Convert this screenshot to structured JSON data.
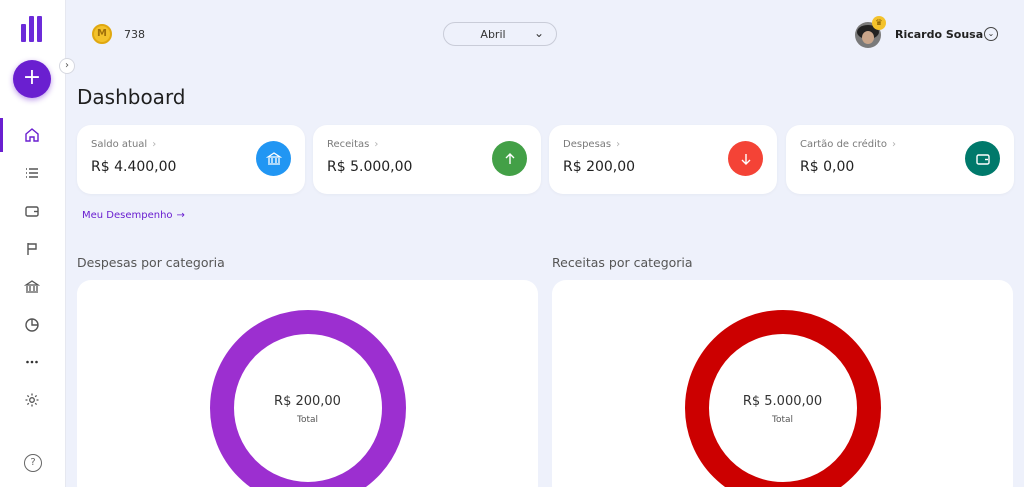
{
  "topbar": {
    "coins": "738",
    "month": "Abril",
    "user_name": "Ricardo Sousa"
  },
  "page": {
    "title": "Dashboard"
  },
  "cards": [
    {
      "label": "Saldo atual",
      "value": "R$ 4.400,00",
      "icon": "bank-icon",
      "color": "#2196f3"
    },
    {
      "label": "Receitas",
      "value": "R$ 5.000,00",
      "icon": "arrow-up-icon",
      "color": "#43a047"
    },
    {
      "label": "Despesas",
      "value": "R$ 200,00",
      "icon": "arrow-down-icon",
      "color": "#f44336"
    },
    {
      "label": "Cartão de crédito",
      "value": "R$ 0,00",
      "icon": "wallet-icon",
      "color": "#00796b"
    }
  ],
  "performance_link": "Meu Desempenho",
  "charts": [
    {
      "title": "Despesas por categoria",
      "total_value": "R$ 200,00",
      "total_label": "Total",
      "color": "#9c2fd0"
    },
    {
      "title": "Receitas por categoria",
      "total_value": "R$ 5.000,00",
      "total_label": "Total",
      "color": "#cc0000"
    }
  ],
  "colors": {
    "accent": "#6a1fd0",
    "background": "#eef1fb"
  }
}
